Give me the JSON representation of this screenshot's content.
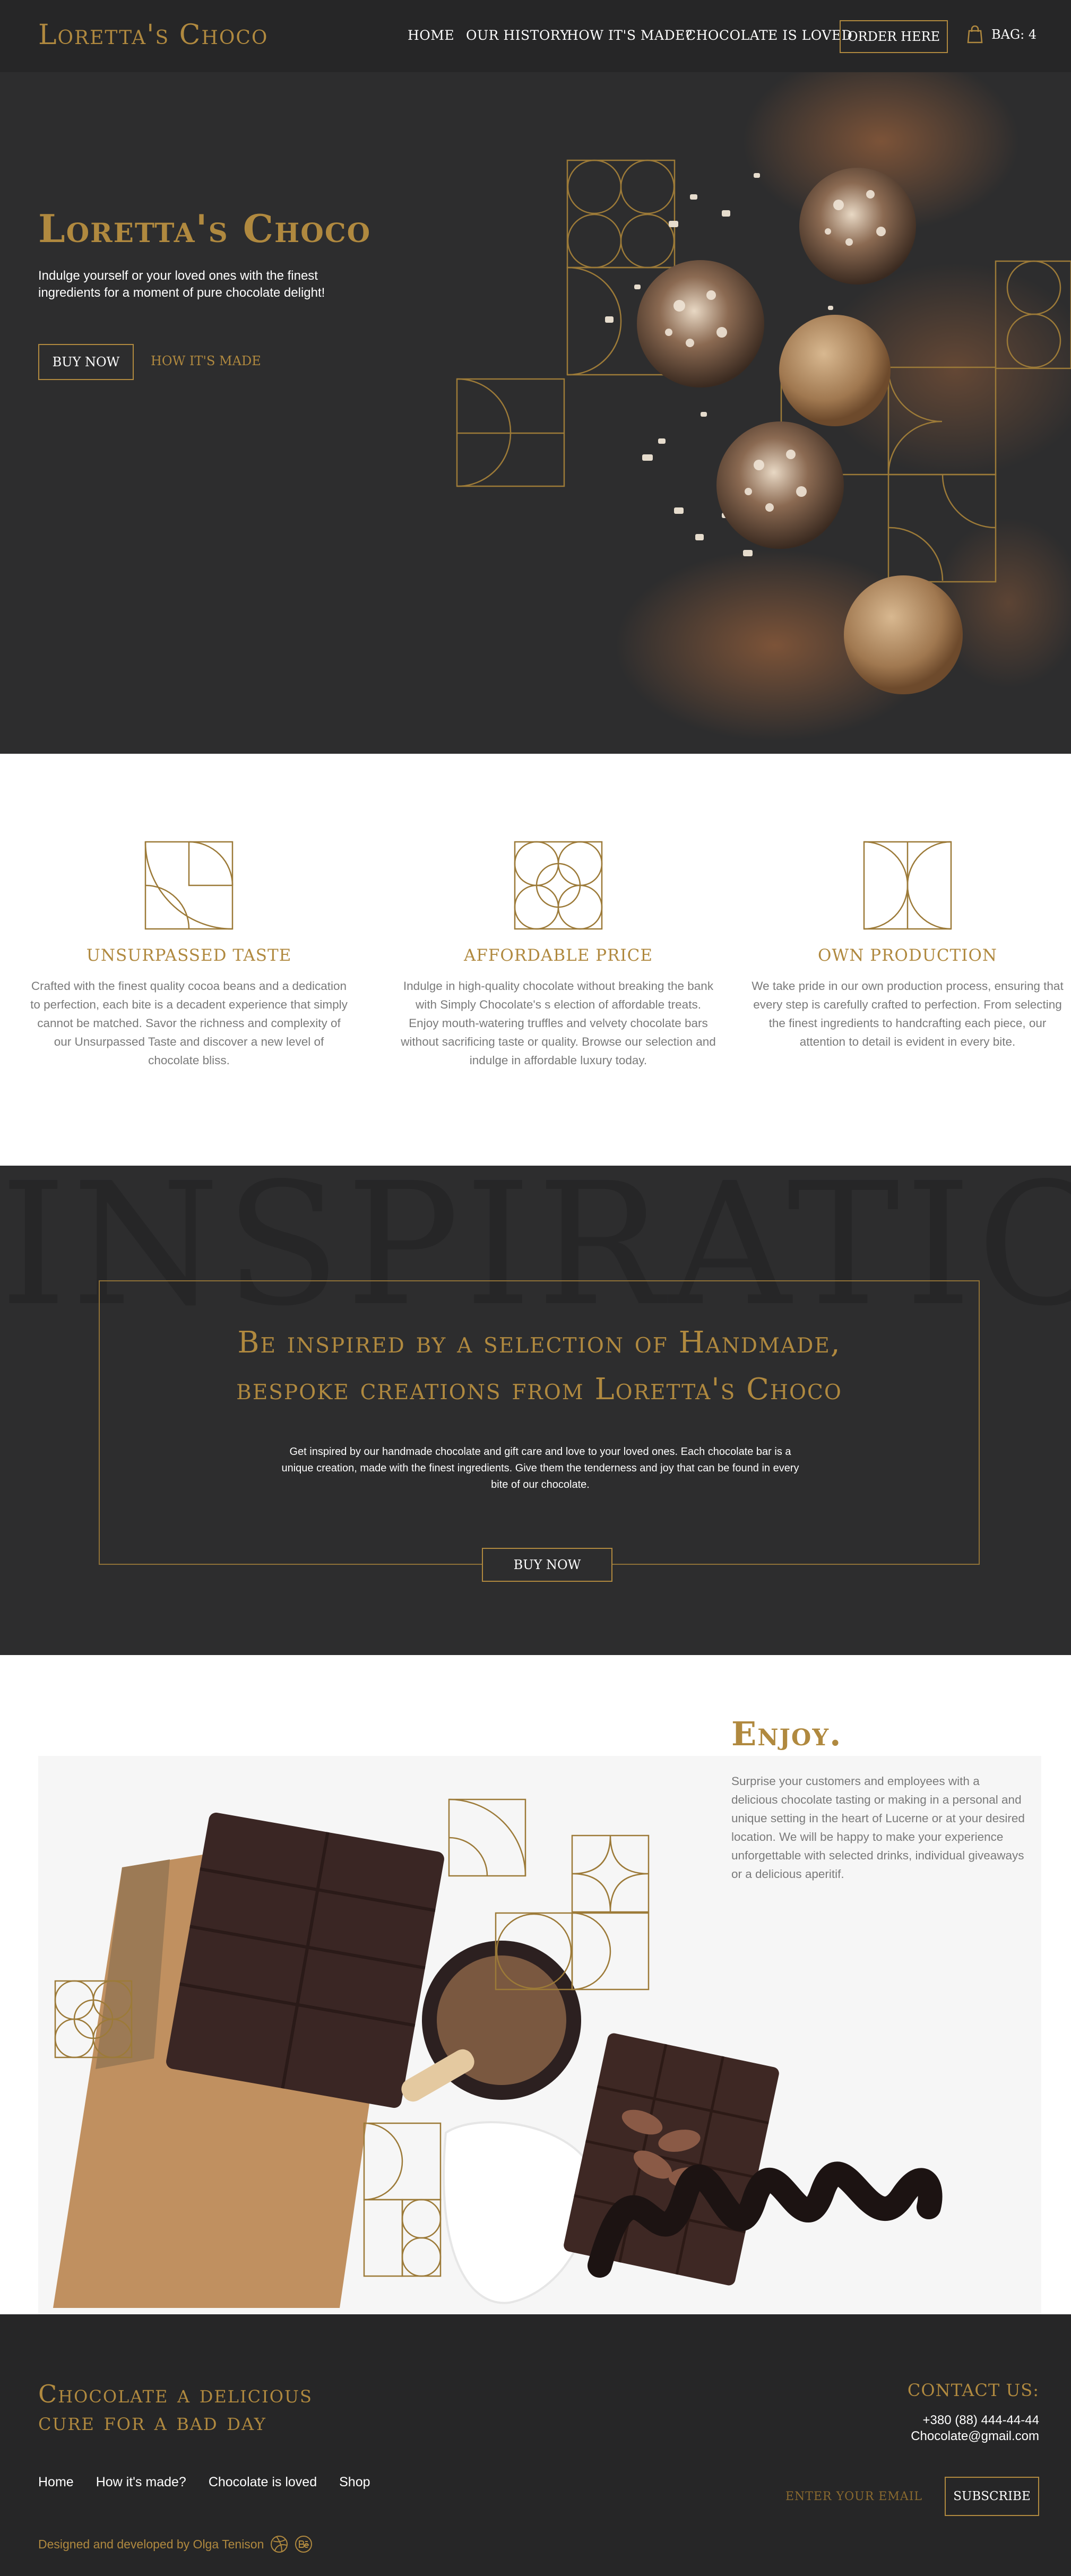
{
  "header": {
    "logo": "Loretta's Choco",
    "nav": [
      "HOME",
      "OUR HISTORY",
      "HOW IT'S MADE?",
      "CHOCOLATE IS LOVED"
    ],
    "order_label": "ORDER HERE",
    "bag_label": "BAG: 4",
    "bag_icon": "shopping-bag-icon"
  },
  "hero": {
    "title": "Loretta's Choco",
    "subtitle": "Indulge yourself or your loved ones with the finest ingredients for a moment of pure chocolate delight!",
    "buy_label": "BUY NOW",
    "how_label": "HOW IT'S MADE"
  },
  "features": [
    {
      "title": "UNSURPASSED TASTE",
      "text": "Crafted with the finest quality cocoa beans and a dedication to perfection, each bite is a decadent experience that simply cannot be matched. Savor the richness and complexity of our Unsurpassed Taste and discover a new level of chocolate bliss."
    },
    {
      "title": "AFFORDABLE PRICE",
      "text": "Indulge in high-quality chocolate without breaking the bank with Simply Chocolate's s election of affordable treats. Enjoy mouth-watering truffles and velvety chocolate bars without sacrificing taste or quality. Browse our selection and indulge in affordable luxury today."
    },
    {
      "title": "OWN PRODUCTION",
      "text": "We take pride in our own production process, ensuring that every step is carefully crafted to perfection. From selecting the finest ingredients to handcrafting each piece, our attention to detail is evident in every bite."
    }
  ],
  "inspiration": {
    "background_word": "INSPIRATION",
    "title_line1": "Be inspired by a selection of Handmade,",
    "title_line2": "bespoke creations from Loretta's Choco",
    "text": "Get inspired by our handmade chocolate and gift care and love to your loved ones. Each chocolate bar is a unique creation, made with the finest ingredients. Give them the tenderness and joy that can be found in every bite of our chocolate.",
    "buy_label": "BUY NOW"
  },
  "enjoy": {
    "title": "Enjoy.",
    "text": "Surprise your customers and employees with a delicious chocolate tasting or making in a personal and unique setting in the heart of Lucerne or at your desired location. We will be happy to make your experience unforgettable with selected drinks, individual giveaways or a delicious aperitif."
  },
  "footer": {
    "slogan_line1": "Chocolate a delicious",
    "slogan_line2": "cure for a bad day",
    "links": [
      "Home",
      "How it's made?",
      "Chocolate is loved",
      "Shop"
    ],
    "credit": "Designed and developed by Olga Tenison",
    "social_icons": [
      "dribbble-icon",
      "behance-icon"
    ],
    "contact_title": "CONTACT US:",
    "phone": "+380 (88) 444-44-44",
    "email": "Chocolate@gmail.com",
    "email_placeholder": "ENTER YOUR EMAIL",
    "subscribe_label": "SUBSCRIBE"
  },
  "colors": {
    "accent_gold": "#b0893f",
    "dark_bg": "#2d2d2e",
    "header_bg": "#262627",
    "light_bg": "#ffffff"
  }
}
